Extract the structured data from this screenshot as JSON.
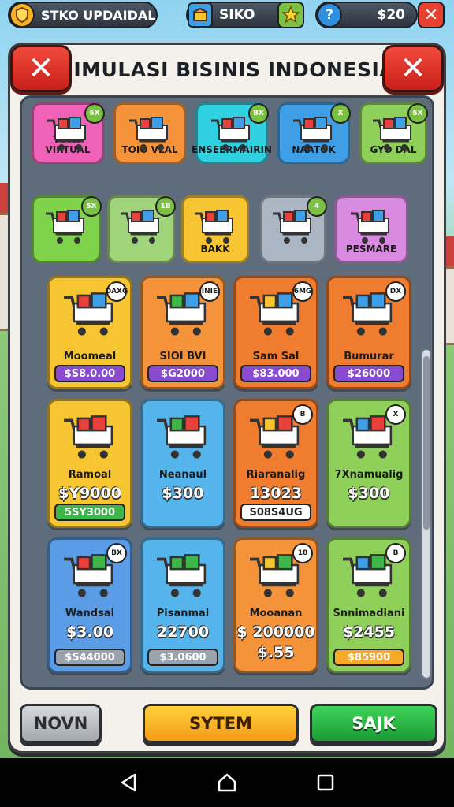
{
  "hud": {
    "store_label": "STKO UPDAIDAL",
    "store_icon": "shield-icon",
    "shop_label": "SIKO",
    "shop_icon": "box-icon",
    "star_icon": "star-icon",
    "money_label": "$20",
    "help_icon": "question-icon",
    "close_icon": "close-icon"
  },
  "panel": {
    "title": "SIMULASI BISINIS INDONESIA",
    "close_left_icon": "close-icon",
    "close_right_icon": "close-icon"
  },
  "categories": [
    {
      "label": "TOKO VIRTUAL",
      "badge": "5X",
      "color": "#f062b8"
    },
    {
      "label": "TOIO VLAL",
      "badge": "",
      "color": "#f4933a"
    },
    {
      "label": "ENSEERMAIRIN",
      "badge": "BX",
      "color": "#2fd0e0"
    },
    {
      "label": "NAATOK",
      "badge": "X",
      "color": "#3e9fe6"
    },
    {
      "label": "GYO DAL",
      "badge": "5X",
      "color": "#8fd05a"
    },
    {
      "label": "",
      "badge": "5X",
      "color": "#7fd34a"
    },
    {
      "label": "",
      "badge": "1B",
      "color": "#9fd47a"
    },
    {
      "label": "BAKK",
      "badge": "",
      "color": "#f7c531"
    },
    {
      "label": "",
      "badge": "4",
      "color": "#aab6c4"
    },
    {
      "label": "PESMARE",
      "badge": "",
      "color": "#d88ae0"
    }
  ],
  "items": [
    {
      "name": "Moomeal",
      "badge": "DAXG",
      "price": "",
      "pill": "$S8.0.00",
      "color": "#f7c531",
      "pill_color": "#8a4ad0"
    },
    {
      "name": "SIOI BVI",
      "badge": "INIE",
      "price": "",
      "pill": "$G2000",
      "color": "#f4933a",
      "pill_color": "#8a4ad0"
    },
    {
      "name": "Sam Sal",
      "badge": "6MG",
      "price": "",
      "pill": "$83.000",
      "color": "#f07c30",
      "pill_color": "#8a4ad0"
    },
    {
      "name": "Bumurar",
      "badge": "DX",
      "price": "",
      "pill": "$26000",
      "color": "#f07c30",
      "pill_color": "#8a4ad0"
    },
    {
      "name": "Ramoal",
      "badge": "",
      "price": "$Y9000",
      "pill": "5SY3000",
      "color": "#f7c531",
      "pill_color": "#3eb64a"
    },
    {
      "name": "Neanaul",
      "badge": "",
      "price": "$300",
      "pill": "",
      "color": "#56b4ec",
      "pill_color": ""
    },
    {
      "name": "Riaranalig",
      "badge": "B",
      "price": "13023",
      "pill": "S08S4UG",
      "color": "#f07c30",
      "pill_color": "#ffffff"
    },
    {
      "name": "7Xnamualig",
      "badge": "X",
      "price": "$300",
      "pill": "",
      "color": "#8fd05a",
      "pill_color": ""
    },
    {
      "name": "Wandsal",
      "badge": "BX",
      "price": "$3.00",
      "pill": "$S44000",
      "color": "#5a9de6",
      "pill_color": "#9aa2ad"
    },
    {
      "name": "Pisanmal",
      "badge": "",
      "price": "22700",
      "pill": "$3.0600",
      "color": "#56b4ec",
      "pill_color": "#9aa2ad"
    },
    {
      "name": "Mooanan",
      "badge": "18",
      "price": "$ 200000",
      "pill": "$.55",
      "color": "#f4933a",
      "pill_color": ""
    },
    {
      "name": "Snnimadiani",
      "badge": "B",
      "price": "$2455",
      "pill": "$85900",
      "color": "#8fd05a",
      "pill_color": "#f7a928"
    }
  ],
  "bottom": {
    "left_label": "NOVN",
    "middle_label": "SYTEM",
    "right_label": "SAJK"
  },
  "nav": {
    "back_icon": "back-triangle-icon",
    "home_icon": "home-icon",
    "recents_icon": "recents-square-icon"
  }
}
